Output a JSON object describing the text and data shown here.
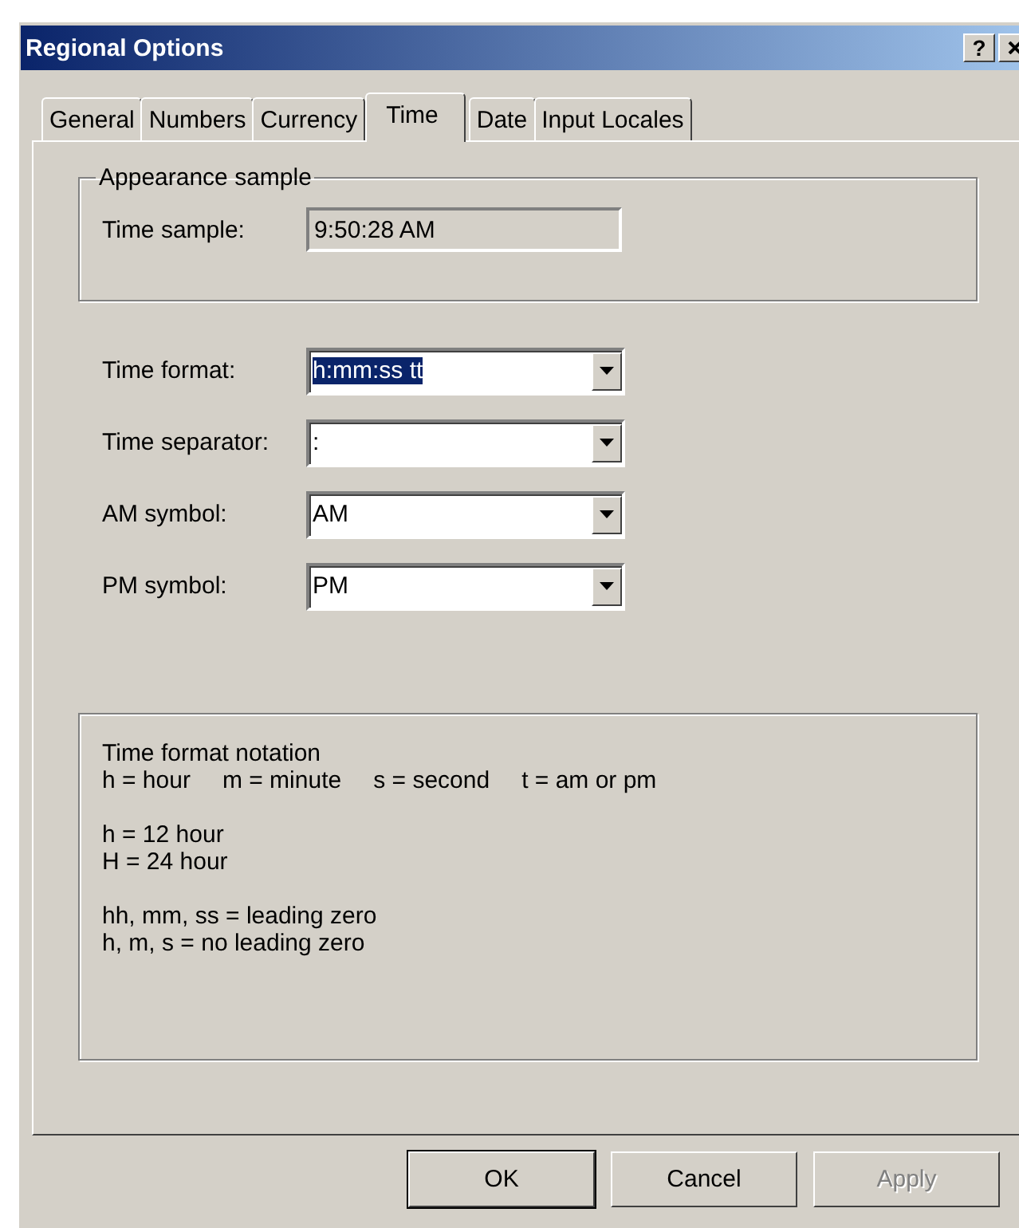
{
  "window": {
    "title": "Regional Options",
    "help": "?"
  },
  "tabs": [
    {
      "label": "General",
      "selected": false
    },
    {
      "label": "Numbers",
      "selected": false
    },
    {
      "label": "Currency",
      "selected": false
    },
    {
      "label": "Time",
      "selected": true
    },
    {
      "label": "Date",
      "selected": false
    },
    {
      "label": "Input Locales",
      "selected": false
    }
  ],
  "appearance_sample": {
    "title": "Appearance sample",
    "label": "Time sample:",
    "value": "9:50:28 AM"
  },
  "settings": [
    {
      "label": "Time format:",
      "value": "h:mm:ss tt",
      "highlighted": true
    },
    {
      "label": "Time separator:",
      "value": ":",
      "highlighted": false
    },
    {
      "label": "AM symbol:",
      "value": "AM",
      "highlighted": false
    },
    {
      "label": "PM symbol:",
      "value": "PM",
      "highlighted": false
    }
  ],
  "notation": {
    "title": "Time format notation",
    "legend": [
      "h = hour",
      "m = minute",
      "s = second",
      "t = am or pm"
    ],
    "lines": [
      [
        "h = 12 hour",
        "H = 24 hour"
      ],
      [
        "hh, mm, ss = leading zero",
        "h, m, s = no leading zero"
      ]
    ]
  },
  "buttons": [
    {
      "label": "OK",
      "disabled": false,
      "default": true
    },
    {
      "label": "Cancel",
      "disabled": false,
      "default": false
    },
    {
      "label": "Apply",
      "disabled": true,
      "default": false
    }
  ]
}
